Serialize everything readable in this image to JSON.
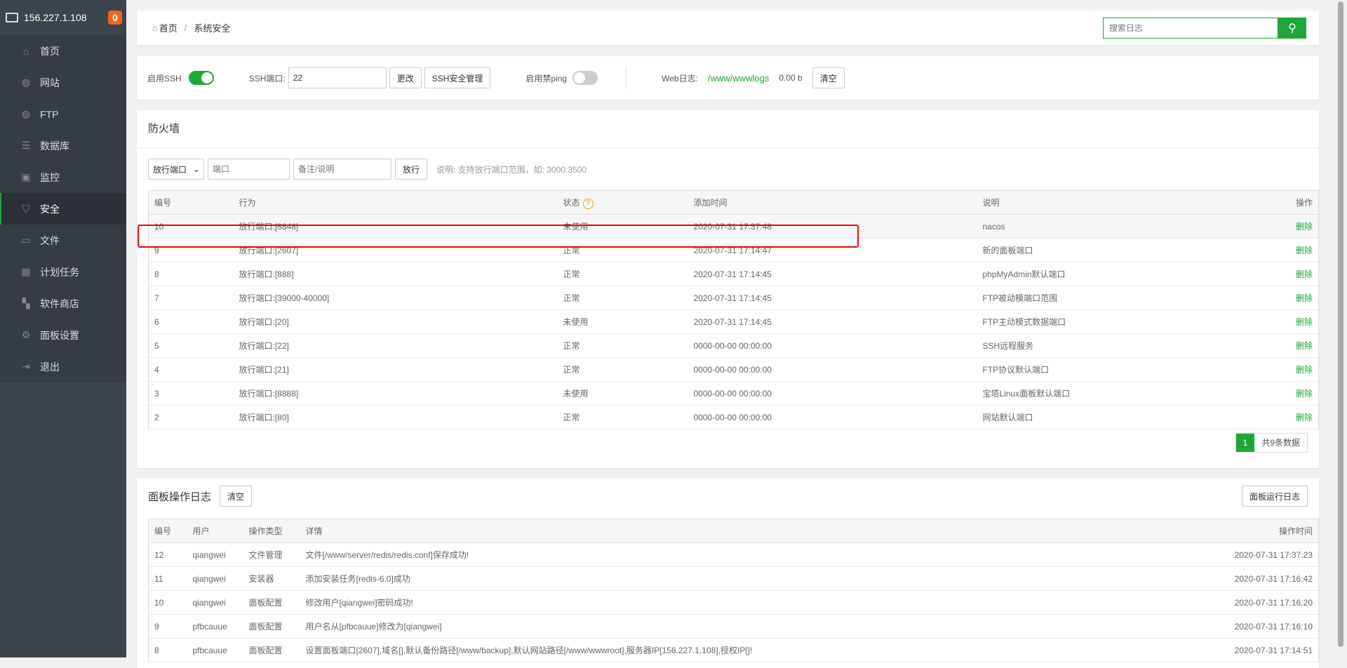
{
  "sidebar": {
    "host": "156.227.1.108",
    "badge": "0",
    "items": [
      {
        "label": "首页",
        "icon": "⌂"
      },
      {
        "label": "网站",
        "icon": "◍"
      },
      {
        "label": "FTP",
        "icon": "◍"
      },
      {
        "label": "数据库",
        "icon": "☰"
      },
      {
        "label": "监控",
        "icon": "▣"
      },
      {
        "label": "安全",
        "icon": "⛉"
      },
      {
        "label": "文件",
        "icon": "▭"
      },
      {
        "label": "计划任务",
        "icon": "▦"
      },
      {
        "label": "软件商店",
        "icon": "▚"
      },
      {
        "label": "面板设置",
        "icon": "⚙"
      },
      {
        "label": "退出",
        "icon": "⇥"
      }
    ]
  },
  "breadcrumb": {
    "home": "首页",
    "current": "系统安全"
  },
  "search": {
    "placeholder": "搜索日志"
  },
  "options": {
    "ssh_label": "启用SSH",
    "ssh_port_label": "SSH端口:",
    "ssh_port": "22",
    "change": "更改",
    "ssh_manage": "SSH安全管理",
    "ping_label": "启用禁ping",
    "weblog_label": "Web日志:",
    "weblog_path": "/www/wwwlogs",
    "weblog_size": "0.00 b",
    "clear": "清空"
  },
  "firewall": {
    "title": "防火墙",
    "select": "放行端口",
    "port_placeholder": "端口",
    "note_placeholder": "备注/说明",
    "submit": "放行",
    "hint": "说明: 支持放行端口范围，如: 3000:3500",
    "headers": [
      "编号",
      "行为",
      "状态",
      "添加时间",
      "说明",
      "操作"
    ],
    "rows": [
      [
        "10",
        "放行端口:[8848]",
        "未使用",
        "2020-07-31 17:37:48",
        "nacos",
        "删除"
      ],
      [
        "9",
        "放行端口:[2607]",
        "正常",
        "2020-07-31 17:14:47",
        "新的面板端口",
        "删除"
      ],
      [
        "8",
        "放行端口:[888]",
        "正常",
        "2020-07-31 17:14:45",
        "phpMyAdmin默认端口",
        "删除"
      ],
      [
        "7",
        "放行端口:[39000-40000]",
        "正常",
        "2020-07-31 17:14:45",
        "FTP被动模端口范围",
        "删除"
      ],
      [
        "6",
        "放行端口:[20]",
        "未使用",
        "2020-07-31 17:14:45",
        "FTP主动模式数据端口",
        "删除"
      ],
      [
        "5",
        "放行端口:[22]",
        "正常",
        "0000-00-00 00:00:00",
        "SSH远程服务",
        "删除"
      ],
      [
        "4",
        "放行端口:[21]",
        "正常",
        "0000-00-00 00:00:00",
        "FTP协议默认端口",
        "删除"
      ],
      [
        "3",
        "放行端口:[8888]",
        "未使用",
        "0000-00-00 00:00:00",
        "宝塔Linux面板默认端口",
        "删除"
      ],
      [
        "2",
        "放行端口:[80]",
        "正常",
        "0000-00-00 00:00:00",
        "网站默认端口",
        "删除"
      ]
    ],
    "page": "1",
    "total": "共9条数据"
  },
  "logs": {
    "title": "面板操作日志",
    "clear": "清空",
    "run_log": "面板运行日志",
    "headers": [
      "编号",
      "用户",
      "操作类型",
      "详情",
      "操作时间"
    ],
    "rows": [
      [
        "12",
        "qiangwei",
        "文件管理",
        "文件[/www/server/redis/redis.conf]保存成功!",
        "2020-07-31 17:37:23"
      ],
      [
        "11",
        "qiangwei",
        "安装器",
        "添加安装任务[redis-6.0]成功",
        "2020-07-31 17:16:42"
      ],
      [
        "10",
        "qiangwei",
        "面板配置",
        "修改用户[qiangwei]密码成功!",
        "2020-07-31 17:16:20"
      ],
      [
        "9",
        "pfbcauue",
        "面板配置",
        "用户名从[pfbcauue]修改为[qiangwei]",
        "2020-07-31 17:16:10"
      ],
      [
        "8",
        "pfbcauue",
        "面板配置",
        "设置面板端口[2607],域名[],默认备份路径[/www/backup],默认网站路径[/www/wwwroot],服务器IP[156.227.1.108],授权IP[]!",
        "2020-07-31 17:14:51"
      ]
    ]
  }
}
